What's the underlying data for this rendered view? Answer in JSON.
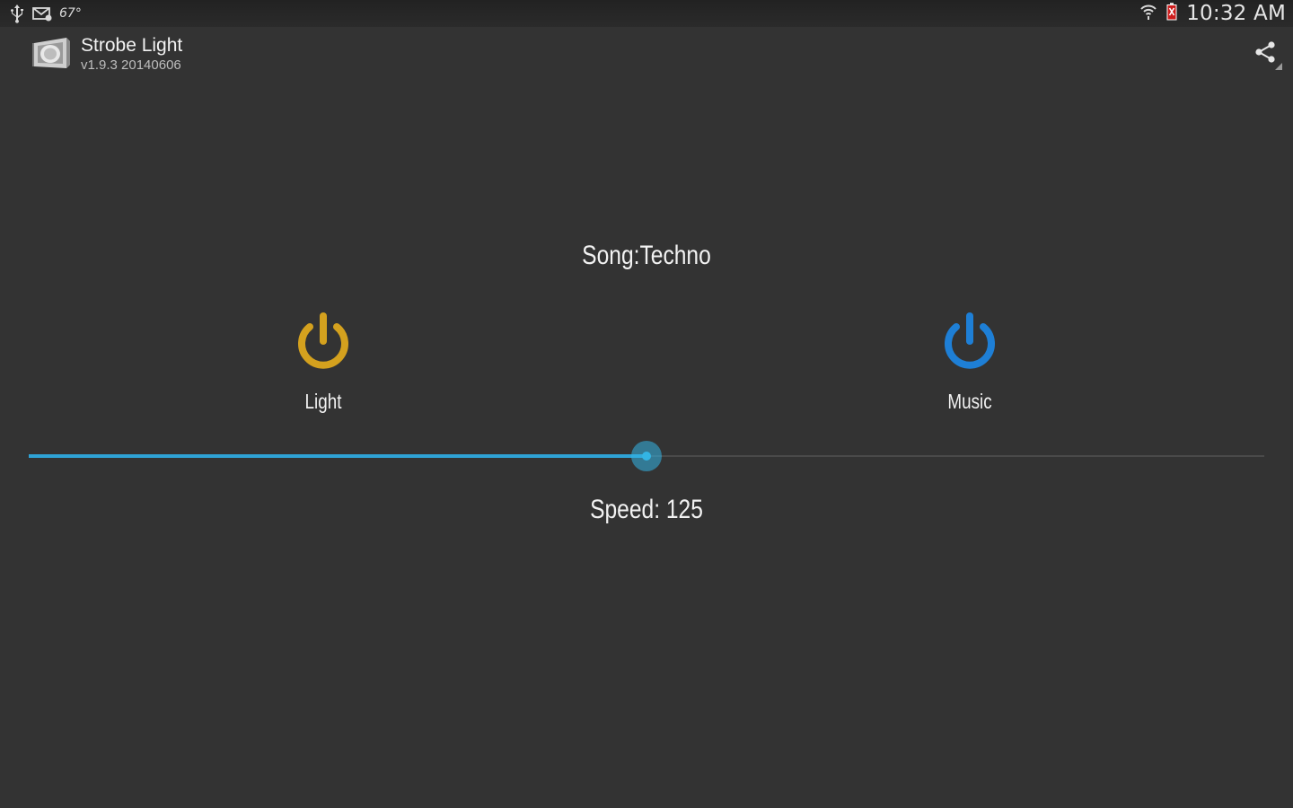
{
  "status_bar": {
    "temperature": "67°",
    "time": "10:32 AM",
    "icons": [
      "usb-icon",
      "mail-icon",
      "wifi-icon",
      "battery-icon"
    ]
  },
  "app": {
    "title": "Strobe Light",
    "version": "v1.9.3 20140606",
    "share_icon": "share-icon"
  },
  "main": {
    "song_label": "Song:Techno",
    "light": {
      "label": "Light",
      "icon": "power-icon",
      "color": "#d4a11e"
    },
    "music": {
      "label": "Music",
      "icon": "power-icon",
      "color": "#1e7fd6"
    },
    "speed": {
      "prefix": "Speed: ",
      "value": 125,
      "display": "Speed: 125",
      "slider_fraction": 0.5,
      "accent_color": "#33b5e5"
    }
  }
}
